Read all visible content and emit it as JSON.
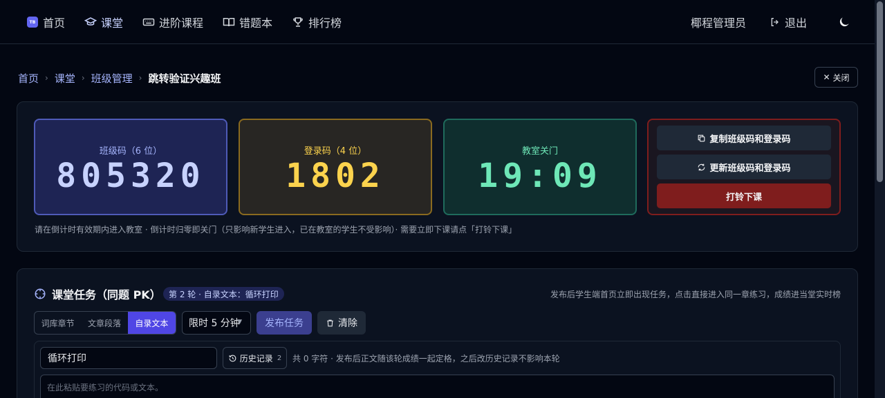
{
  "nav": {
    "items": [
      {
        "label": "首页",
        "icon": "logo-icon"
      },
      {
        "label": "课堂",
        "icon": "graduation-cap-icon",
        "active": true
      },
      {
        "label": "进阶课程",
        "icon": "keyboard-icon"
      },
      {
        "label": "错题本",
        "icon": "book-open-icon"
      },
      {
        "label": "排行榜",
        "icon": "trophy-icon"
      }
    ],
    "logo_text": "TB",
    "user": "椰程管理员",
    "logout": "退出",
    "theme_icon": "moon-icon"
  },
  "breadcrumb": {
    "items": [
      "首页",
      "课堂",
      "班级管理"
    ],
    "current": "跳转验证兴趣班"
  },
  "close_label": "关闭",
  "classroom": {
    "class_code_label": "班级码（6 位）",
    "class_code": "805320",
    "login_code_label": "登录码（4 位）",
    "login_code": "1802",
    "closing_label": "教室关门",
    "closing_time": "19:09",
    "copy_label": "复制班级码和登录码",
    "refresh_label": "更新班级码和登录码",
    "end_label": "打铃下课",
    "hint": "请在倒计时有效期内进入教室 · 倒计时归零即关门（只影响新学生进入，已在教室的学生不受影响）· 需要立即下课请点「打铃下课」"
  },
  "task": {
    "title": "课堂任务（同题 PK）",
    "round_badge": "第 2 轮 · 自录文本：循环打印",
    "note": "发布后学生端首页立即出现任务，点击直接进入同一章练习，成绩进当堂实时榜",
    "modes": [
      "词库章节",
      "文章段落",
      "自录文本"
    ],
    "active_mode": "自录文本",
    "time_limit": "限时 5 分钟",
    "publish_label": "发布任务",
    "clear_label": "清除",
    "text_title": "循环打印",
    "history_label": "历史记录",
    "history_count": "2",
    "char_note": "共 0 字符 · 发布后正文随该轮成绩一起定格，之后改历史记录不影响本轮",
    "textarea_placeholder": "在此粘贴要练习的代码或文本。"
  },
  "colors": {
    "accent": "#4f46e5",
    "class_code": "#c7d2fe",
    "login_code": "#fcd34d",
    "closing": "#6ee7b7",
    "danger": "#7f1d1d"
  }
}
